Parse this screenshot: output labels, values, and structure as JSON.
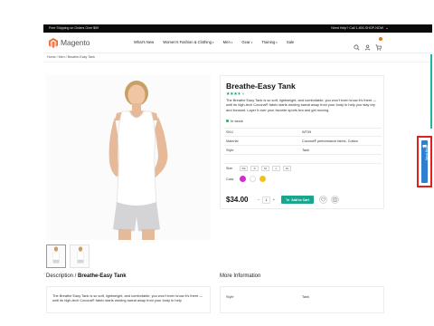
{
  "promo_bar": {
    "left_text": "Free Shipping on Orders Over $99",
    "right_text": "Need Help? Call 1-800-SHOP-NOW"
  },
  "header": {
    "logo_text": "Magento",
    "nav": [
      {
        "label": "What's New",
        "dropdown": false
      },
      {
        "label": "Women's Fashion & Clothing",
        "dropdown": true
      },
      {
        "label": "Men",
        "dropdown": true
      },
      {
        "label": "Gear",
        "dropdown": true
      },
      {
        "label": "Training",
        "dropdown": true
      },
      {
        "label": "Sale",
        "dropdown": false
      }
    ],
    "icons": [
      "search-icon",
      "account-icon",
      "cart-icon"
    ],
    "cart_count": "1"
  },
  "breadcrumb": "Home / Men / Breathe-Easy Tank",
  "product": {
    "title": "Breathe-Easy Tank",
    "rating_stars": 3.5,
    "description": "The Breathe Easy Tank is so soft, lightweight, and comfortable, you won't even know it's there — until its high-tech Cocona® fabric starts wicking sweat away from your body to help you stay dry and focused. Layer it over your favorite sports bra and get moving.",
    "stock": "In stock",
    "specs": [
      {
        "key": "SKU",
        "value": "WT09"
      },
      {
        "key": "Material",
        "value": "Cocona® performance fabric, Cotton"
      },
      {
        "key": "Style",
        "value": "Tank"
      },
      {
        "key": "",
        "value": ""
      }
    ],
    "size_label": "Size",
    "sizes": [
      "XS",
      "S",
      "M",
      "L",
      "XL"
    ],
    "color_label": "Color",
    "colors": [
      "#d92ad0",
      "#ffffff",
      "#f2c21b"
    ],
    "price": "$34.00",
    "quantity": "1",
    "add_to_cart_label": "Add to Cart"
  },
  "sections": {
    "description_title_prefix": "Description / ",
    "description_title_name": "Breathe-Easy Tank",
    "description_text": "The Breathe Easy Tank is so soft, lightweight, and comfortable, you won't even know it's there — until its high-tech Cocona® fabric starts wicking sweat away from your body to help",
    "more_info_title": "More Information",
    "more_info_rows": [
      {
        "key": "Style",
        "value": "Tank"
      }
    ]
  },
  "side_tab": {
    "label": "Need Help?"
  },
  "colors": {
    "accent": "#1aa58f",
    "stars": "#18a086",
    "topbar": "#0a0a0a",
    "side_tab": "#2f7fd1",
    "highlight_border": "#e0201e"
  }
}
